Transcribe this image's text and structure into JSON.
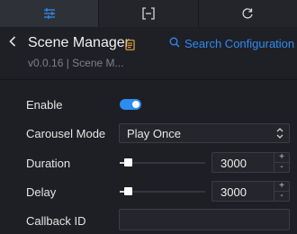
{
  "tabs": [
    {
      "name": "settings-sliders-icon",
      "active": true
    },
    {
      "name": "bracket-icon",
      "active": false
    },
    {
      "name": "refresh-icon",
      "active": false
    }
  ],
  "header": {
    "title": "Scene Manager",
    "version": "v0.0.16 | Scene M...",
    "search_label": "Search Configuration"
  },
  "fields": {
    "enable": {
      "label": "Enable",
      "value": true
    },
    "carousel_mode": {
      "label": "Carousel Mode",
      "value": "Play Once"
    },
    "duration": {
      "label": "Duration",
      "value": "3000"
    },
    "delay": {
      "label": "Delay",
      "value": "3000"
    },
    "callback_id": {
      "label": "Callback ID",
      "value": ""
    }
  },
  "colors": {
    "accent": "#2d8cf0",
    "background": "#1e1f24"
  }
}
